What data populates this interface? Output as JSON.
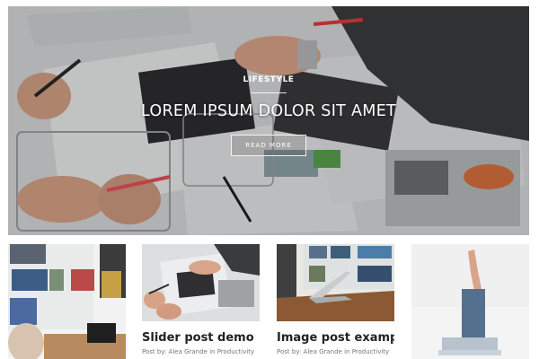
{
  "hero": {
    "category": "LIFESTYLE",
    "title": "LOREM IPSUM DOLOR SIT AMET",
    "button_label": "READ MORE"
  },
  "posts": [
    {
      "title": "",
      "meta": ""
    },
    {
      "title": "Slider post demo",
      "meta": "Post by: Alea Grande in Productivity"
    },
    {
      "title": "Image post example",
      "meta": "Post by: Alea Grande in Productivity"
    },
    {
      "title": "",
      "meta": ""
    }
  ]
}
